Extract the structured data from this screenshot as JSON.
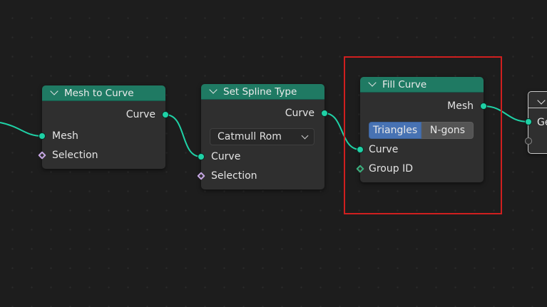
{
  "colors": {
    "background": "#1d1d1d",
    "node_body": "#2f2f2f",
    "node_header": "#1f7a63",
    "geometry_socket": "#1fd1a6",
    "field_socket": "#c5a6e2",
    "int_field_socket": "#3bb07e",
    "active_toggle": "#4772b3",
    "highlight_box": "#d01f1f",
    "wire": "#1fd1a6"
  },
  "nodes": {
    "mesh_to_curve": {
      "title": "Mesh to Curve",
      "outputs": [
        "Curve"
      ],
      "inputs": [
        "Mesh",
        "Selection"
      ]
    },
    "set_spline_type": {
      "title": "Set Spline Type",
      "outputs": [
        "Curve"
      ],
      "spline_type": "Catmull Rom",
      "inputs": [
        "Curve",
        "Selection"
      ]
    },
    "fill_curve": {
      "title": "Fill Curve",
      "outputs": [
        "Mesh"
      ],
      "mode_options": [
        "Triangles",
        "N-gons"
      ],
      "mode_selected": "Triangles",
      "inputs": [
        "Curve",
        "Group ID"
      ]
    },
    "next_node": {
      "input_label": "Ge"
    }
  },
  "icons": {
    "collapse": "chevron-down-icon",
    "dropdown": "chevron-down-icon"
  }
}
